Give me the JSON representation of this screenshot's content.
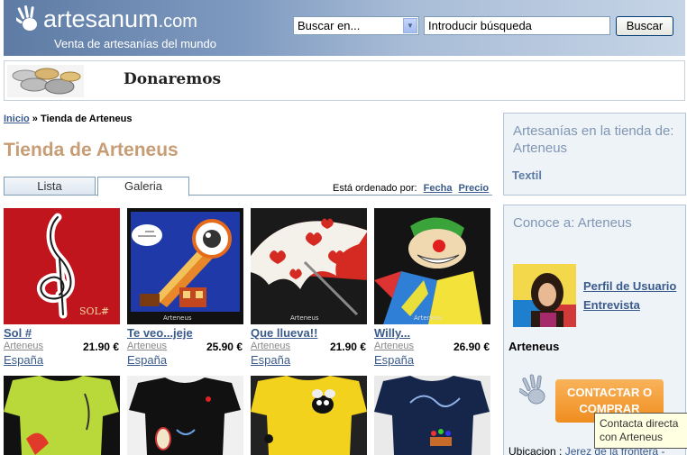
{
  "header": {
    "logo_main": "artesanum",
    "logo_suffix": ".com",
    "tagline": "Venta de artesanías del mundo",
    "search_select": "Buscar en...",
    "search_value": "Introducir búsqueda",
    "search_button": "Buscar"
  },
  "banner": {
    "title": "Donaremos"
  },
  "breadcrumb": {
    "home": "Inicio",
    "separator": "»",
    "current": "Tienda de Arteneus"
  },
  "page_title": "Tienda de Arteneus",
  "tabs": [
    {
      "label": "Lista"
    },
    {
      "label": "Galeria"
    }
  ],
  "sort": {
    "label": "Está ordenado por:",
    "fecha": "Fecha",
    "precio": "Precio"
  },
  "products": [
    {
      "name": "Sol #",
      "seller": "Arteneus",
      "price": "21.90 €",
      "country": "España"
    },
    {
      "name": "Te veo...jeje",
      "seller": "Arteneus",
      "price": "25.90 €",
      "country": "España"
    },
    {
      "name": "Que llueva!!",
      "seller": "Arteneus",
      "price": "21.90 €",
      "country": "España"
    },
    {
      "name": "Willy...",
      "seller": "Arteneus",
      "price": "26.90 €",
      "country": "España"
    }
  ],
  "thumb_captions": {
    "sol": "SOL#",
    "brand": "Arteneus"
  },
  "sidebar": {
    "box1_title": "Artesanías en la tienda de: Arteneus",
    "box1_category": "Textil",
    "box2_title": "Conoce a: Arteneus",
    "link_profile": "Perfil de Usuario",
    "link_interview": "Entrevista",
    "user_name": "Arteneus",
    "contact_button": "CONTACTAR O COMPRAR",
    "location_label": "Ubicacion :",
    "location_value": "Jerez de la frontera -"
  },
  "tooltip": {
    "line1": "Contacta directa",
    "line2": "con Arteneus"
  },
  "colors": {
    "header_blue": "#5d7ba4",
    "title_tan": "#c79d76",
    "link_blue": "#3a5a8c",
    "button_orange": "#ef8d1f"
  }
}
